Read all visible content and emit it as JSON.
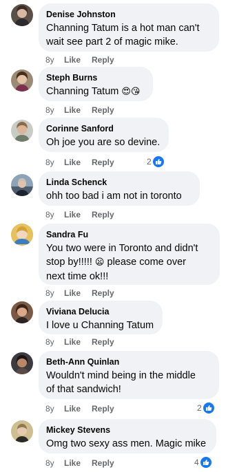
{
  "comments": [
    {
      "name": "Denise Johnston",
      "text": "Channing Tatum is a hot man can't\nwait see part 2 of magic mike.",
      "age": "8y",
      "like": "Like",
      "reply": "Reply"
    },
    {
      "name": "Steph Burns",
      "text": "Channing Tatum",
      "age": "8y",
      "like": "Like",
      "reply": "Reply",
      "emoji": "😍😘"
    },
    {
      "name": "Corinne Sanford",
      "text": "Oh joe you are so devine.",
      "age": "8y",
      "like": "Like",
      "reply": "Reply",
      "reactions": "2"
    },
    {
      "name": "Linda Schenck",
      "text": "ohh too bad i am not in toronto",
      "age": "8y",
      "like": "Like",
      "reply": "Reply"
    },
    {
      "name": "Sandra Fu",
      "text": "You two were in Toronto and didn't\nstop by!!!!! ",
      "text_tail": " please come over\nnext time ok!!!",
      "age": "8y",
      "like": "Like",
      "reply": "Reply",
      "emoji": "😦"
    },
    {
      "name": "Viviana Delucia",
      "text": "I love u Channing Tatum",
      "age": "8y",
      "like": "Like",
      "reply": "Reply"
    },
    {
      "name": "Beth-Ann Quinlan",
      "text": "Wouldn't mind being in the middle\nof that sandwich!",
      "age": "8y",
      "like": "Like",
      "reply": "Reply",
      "reactions": "2"
    },
    {
      "name": "Mickey Stevens",
      "text": "Omg two sexy ass men. Magic mike",
      "age": "8y",
      "like": "Like",
      "reply": "Reply",
      "reactions": "4"
    }
  ],
  "icons": {
    "reaction": "like-thumb-icon"
  },
  "colors": {
    "bubble": "#f0f2f5",
    "meta": "#65676b",
    "like_blue": "#1877f2"
  }
}
